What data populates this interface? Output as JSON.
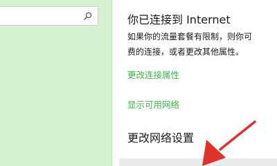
{
  "sidebar": {
    "search": {
      "value": "",
      "icon": "search-icon"
    }
  },
  "main": {
    "title": "你已连接到 Internet",
    "description_line1": "如果你的流量套餐有限制，则你可",
    "description_line2": "费的连接，或者更改其他属性。",
    "links": {
      "change_connection_properties": "更改连接属性",
      "show_available_networks": "显示可用网络"
    },
    "section_heading": "更改网络设置"
  },
  "colors": {
    "sidebar_bg": "#d6f0d2",
    "link": "#3bb24a",
    "arrow": "#e0312b"
  }
}
